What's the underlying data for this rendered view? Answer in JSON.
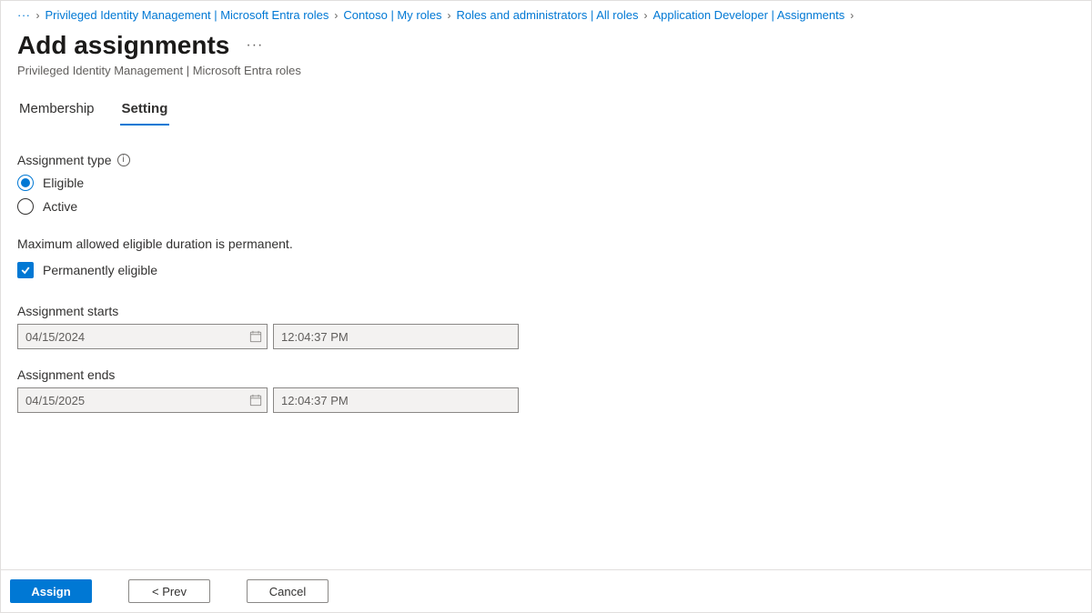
{
  "breadcrumb": {
    "overflow": "···",
    "items": [
      "Privileged Identity Management | Microsoft Entra roles",
      "Contoso | My roles",
      "Roles and administrators | All roles",
      "Application Developer | Assignments"
    ]
  },
  "header": {
    "title": "Add assignments",
    "subtitle": "Privileged Identity Management | Microsoft Entra roles",
    "more": "···"
  },
  "tabs": {
    "items": [
      {
        "label": "Membership",
        "active": false
      },
      {
        "label": "Setting",
        "active": true
      }
    ]
  },
  "form": {
    "assignment_type_label": "Assignment type",
    "assignment_type": {
      "options": [
        {
          "label": "Eligible",
          "checked": true
        },
        {
          "label": "Active",
          "checked": false
        }
      ]
    },
    "duration_note": "Maximum allowed eligible duration is permanent.",
    "permanent": {
      "label": "Permanently eligible",
      "checked": true
    },
    "starts": {
      "label": "Assignment starts",
      "date": "04/15/2024",
      "time": "12:04:37 PM"
    },
    "ends": {
      "label": "Assignment ends",
      "date": "04/15/2025",
      "time": "12:04:37 PM"
    }
  },
  "footer": {
    "assign": "Assign",
    "prev": "<  Prev",
    "cancel": "Cancel"
  }
}
